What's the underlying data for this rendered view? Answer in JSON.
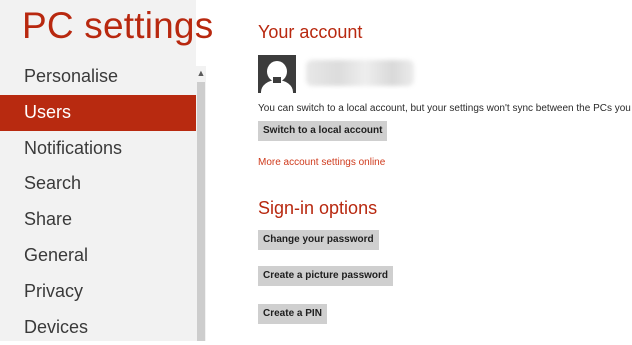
{
  "app": {
    "title": "PC settings"
  },
  "sidebar": {
    "items": [
      {
        "label": "Personalise",
        "selected": false
      },
      {
        "label": "Users",
        "selected": true
      },
      {
        "label": "Notifications",
        "selected": false
      },
      {
        "label": "Search",
        "selected": false
      },
      {
        "label": "Share",
        "selected": false
      },
      {
        "label": "General",
        "selected": false
      },
      {
        "label": "Privacy",
        "selected": false
      },
      {
        "label": "Devices",
        "selected": false
      }
    ]
  },
  "account": {
    "heading": "Your account",
    "info_text": "You can switch to a local account, but your settings won't sync between the PCs you use.",
    "switch_button": "Switch to a local account",
    "more_link": "More account settings online"
  },
  "signin": {
    "heading": "Sign-in options",
    "change_password_button": "Change your password",
    "picture_password_button": "Create a picture password",
    "pin_button": "Create a PIN"
  },
  "colors": {
    "accent": "#b8280f",
    "selected_bg": "#b82a10",
    "sidebar_bg": "#f2f2f2",
    "button_bg": "#cfcfcf",
    "link": "#cf3a1c"
  },
  "icons": {
    "avatar": "user-silhouette-icon",
    "scroll_up": "chevron-up-icon"
  }
}
